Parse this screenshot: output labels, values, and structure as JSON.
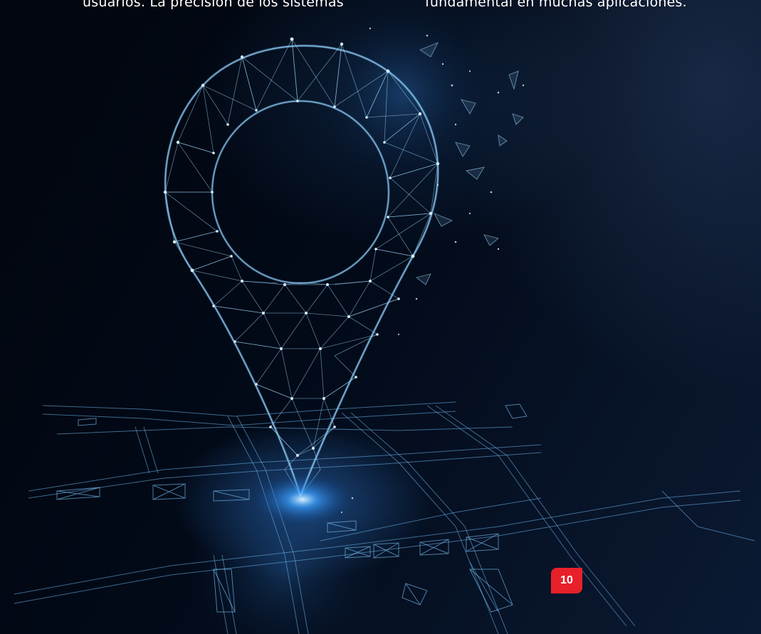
{
  "text": {
    "left_line": "usuarios. La precisión de los sistemas",
    "right_line": "fundamental en muchas aplicaciones."
  },
  "page_number": "10",
  "colors": {
    "background": "#010814",
    "wireframe": "#7fc8ff",
    "badge": "#e8202a"
  },
  "icons": {
    "hero": "location-pin-icon"
  }
}
